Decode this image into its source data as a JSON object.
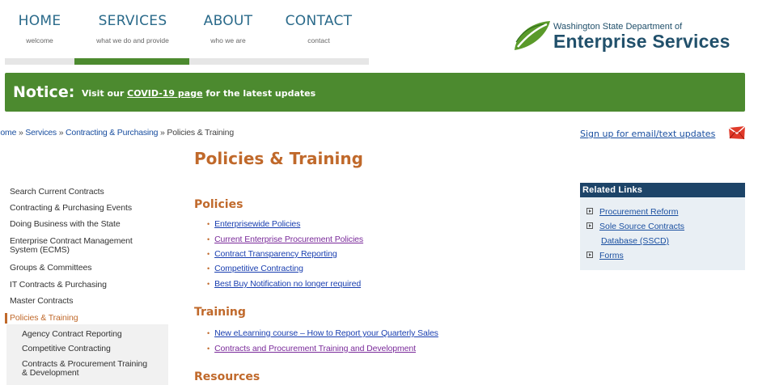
{
  "nav": {
    "items": [
      {
        "title": "HOME",
        "sub": "welcome"
      },
      {
        "title": "SERVICES",
        "sub": "what we do and provide"
      },
      {
        "title": "ABOUT",
        "sub": "who we are"
      },
      {
        "title": "CONTACT",
        "sub": "contact"
      }
    ]
  },
  "logo": {
    "line1": "Washington State Department of",
    "line2": "Enterprise Services"
  },
  "notice": {
    "heading": "Notice:",
    "pre": "Visit our ",
    "link": "COVID-19 page",
    "post": " for the latest updates"
  },
  "breadcrumb": {
    "items": [
      "Home",
      "Services",
      "Contracting & Purchasing"
    ],
    "current": "Policies & Training",
    "separator": "»"
  },
  "signup": "Sign up for email/text updates",
  "page_title": "Policies & Training",
  "sidebar": {
    "items": [
      "Search Current Contracts",
      "Contracting & Purchasing Events",
      "Doing Business with the State",
      "Enterprise Contract Management",
      "System (ECMS)",
      "Groups & Committees",
      "IT Contracts & Purchasing",
      "Master Contracts",
      "Policies & Training"
    ],
    "sub_items": [
      "Agency Contract Reporting",
      "Competitive Contracting",
      "Contracts & Procurement Training",
      "& Development"
    ]
  },
  "sections": {
    "policies": {
      "heading": "Policies",
      "links": [
        "Enterprisewide Policies",
        "Current Enterprise Procurement Policies",
        "Contract Transparency Reporting",
        "Competitive Contracting",
        "Best Buy Notification no longer required"
      ]
    },
    "training": {
      "heading": "Training",
      "links": [
        "New eLearning course – How to Report your Quarterly Sales",
        "Contracts and Procurement Training and Development"
      ]
    },
    "resources": {
      "heading": "Resources"
    }
  },
  "related": {
    "heading": "Related Links",
    "links": [
      "Procurement Reform",
      "Sole Source Contracts",
      "Database (SSCD)",
      "Forms"
    ]
  },
  "colors": {
    "green": "#4c8a2f",
    "orange": "#c0692b",
    "navy": "#1d4468",
    "link": "#1a3fb0",
    "visited": "#7a2a9a"
  }
}
